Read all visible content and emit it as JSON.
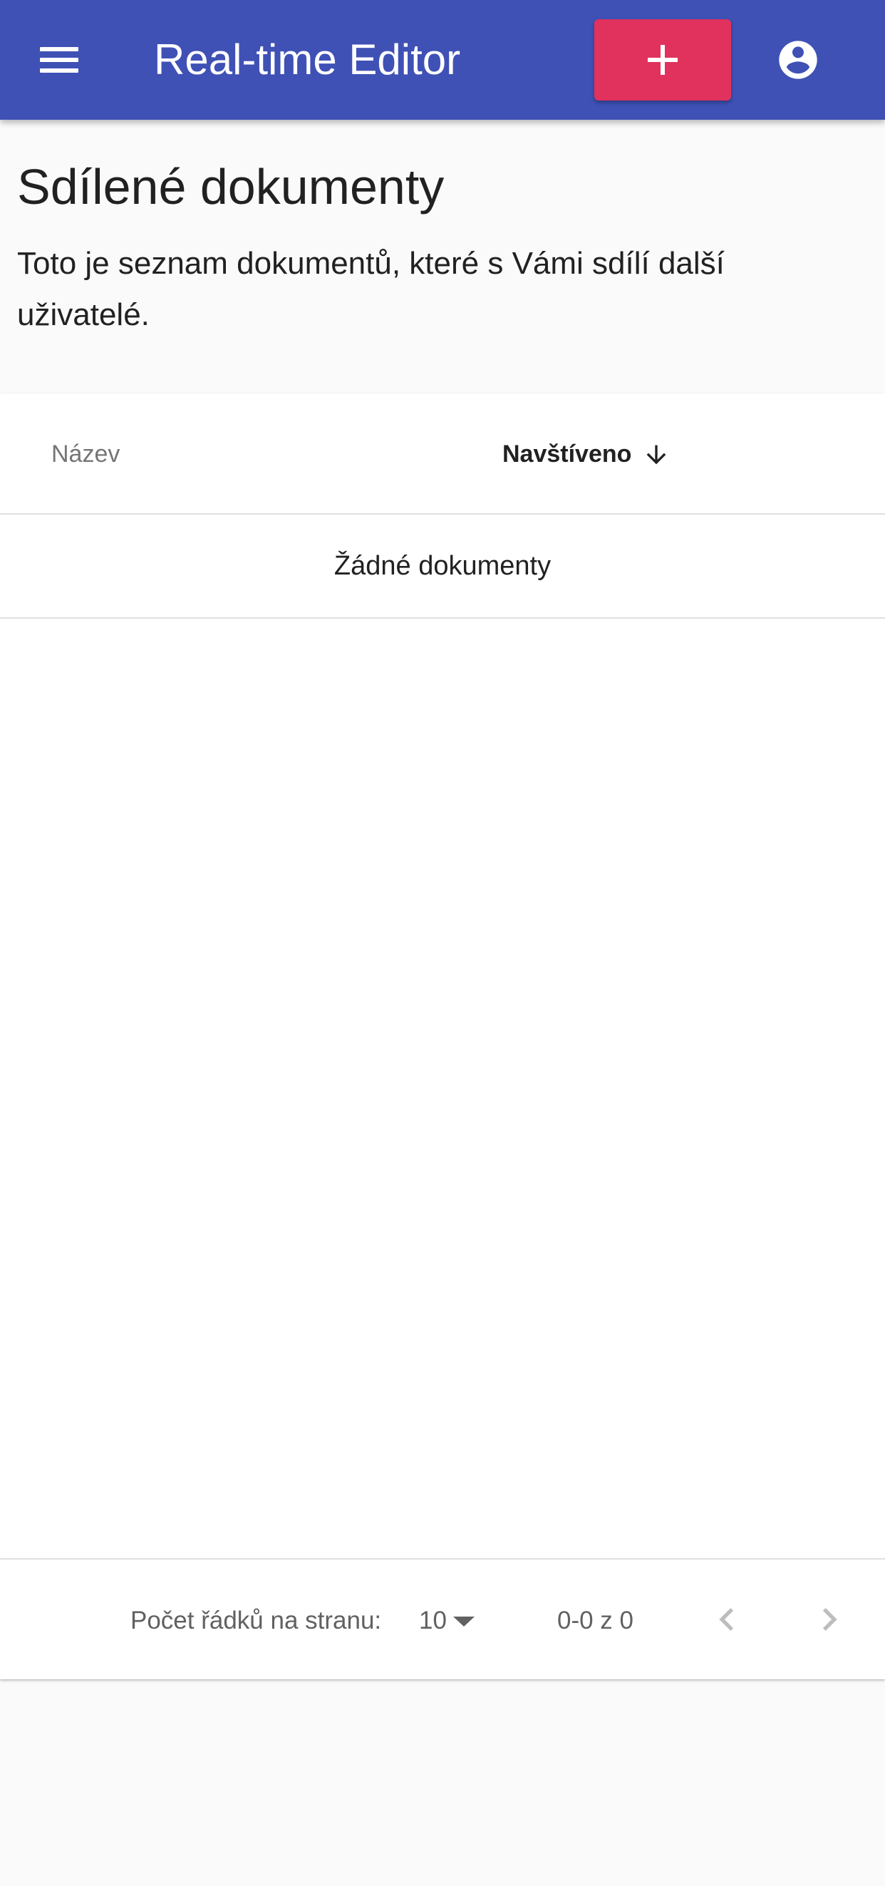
{
  "app_bar": {
    "title": "Real-time Editor",
    "menu_icon": "menu-icon",
    "add_icon": "plus-icon",
    "account_icon": "account-circle-icon",
    "color": "#3f51b5",
    "add_color": "#e0325c"
  },
  "page": {
    "title": "Sdílené dokumenty",
    "description": "Toto je seznam dokumentů, které s Vámi sdílí další uživatelé."
  },
  "table": {
    "columns": [
      {
        "label": "Název",
        "sorted": false
      },
      {
        "label": "Navštíveno",
        "sorted": true,
        "sort_direction": "descending",
        "sort_icon": "arrow-down-icon"
      }
    ],
    "empty_text": "Žádné dokumenty",
    "rows": []
  },
  "pagination": {
    "rows_per_page_label": "Počet řádků na stranu:",
    "rows_per_page_value": "10",
    "range_text": "0-0 z 0",
    "prev_icon": "chevron-left-icon",
    "next_icon": "chevron-right-icon"
  }
}
